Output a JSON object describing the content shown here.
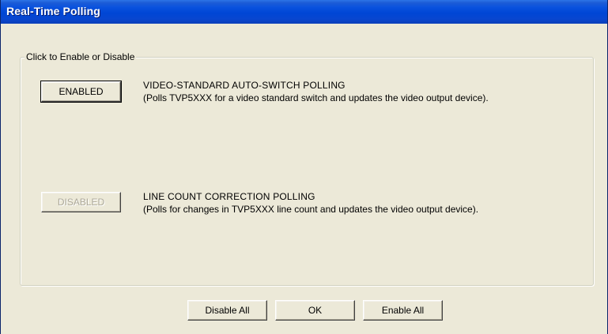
{
  "window": {
    "title": "Real-Time Polling"
  },
  "group": {
    "legend": "Click to Enable or Disable"
  },
  "polls": [
    {
      "state_label": "ENABLED",
      "enabled": true,
      "title": "VIDEO-STANDARD AUTO-SWITCH POLLING",
      "description": "(Polls TVP5XXX for a video standard switch and updates the video output device)."
    },
    {
      "state_label": "DISABLED",
      "enabled": false,
      "title": "LINE COUNT CORRECTION POLLING",
      "description": "(Polls for changes in TVP5XXX line count and updates the video output device)."
    }
  ],
  "footer": {
    "disable_all_label": "Disable All",
    "ok_label": "OK",
    "enable_all_label": "Enable All"
  },
  "colors": {
    "titlebar": "#0A52DE",
    "dialog_bg": "#ECE9D8",
    "disabled_text": "#ACA899"
  }
}
